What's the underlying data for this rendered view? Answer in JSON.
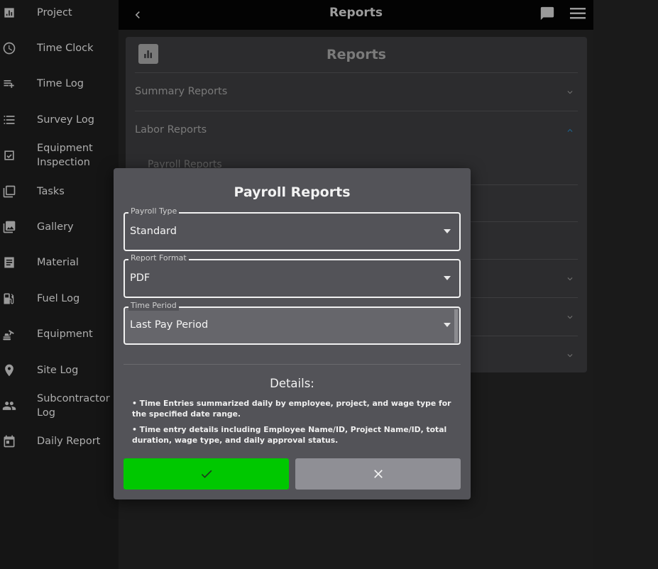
{
  "sidebar": {
    "items": [
      {
        "label": "Project",
        "icon": "bar-chart-icon"
      },
      {
        "label": "Time Clock",
        "icon": "clock-icon"
      },
      {
        "label": "Time Log",
        "icon": "playlist-add-icon"
      },
      {
        "label": "Survey Log",
        "icon": "list-icon"
      },
      {
        "label": "Equipment Inspection",
        "icon": "checkbox-icon"
      },
      {
        "label": "Tasks",
        "icon": "library-icon"
      },
      {
        "label": "Gallery",
        "icon": "photo-library-icon"
      },
      {
        "label": "Material",
        "icon": "receipt-icon"
      },
      {
        "label": "Fuel Log",
        "icon": "gas-station-icon"
      },
      {
        "label": "Equipment",
        "icon": "excavator-icon"
      },
      {
        "label": "Site Log",
        "icon": "location-pin-icon"
      },
      {
        "label": "Subcontractor Log",
        "icon": "people-icon"
      },
      {
        "label": "Daily Report",
        "icon": "calendar-icon"
      }
    ]
  },
  "topbar": {
    "title": "Reports"
  },
  "card": {
    "title": "Reports",
    "sections": {
      "summary": "Summary Reports",
      "labor": "Labor Reports",
      "payroll": "Payroll Reports"
    }
  },
  "dialog": {
    "title": "Payroll Reports",
    "fields": {
      "payroll_type": {
        "label": "Payroll Type",
        "value": "Standard"
      },
      "report_format": {
        "label": "Report Format",
        "value": "PDF"
      },
      "time_period": {
        "label": "Time Period",
        "value": "Last Pay Period"
      }
    },
    "details_title": "Details:",
    "details": [
      "• Time Entries summarized daily by employee, project, and wage type for the specified date range.",
      "• Time entry details including Employee Name/ID, Project Name/ID, total duration, wage type, and daily approval status."
    ]
  },
  "colors": {
    "confirm": "#00c800",
    "cancel": "#8f8f95",
    "dialog_bg": "#535358"
  }
}
